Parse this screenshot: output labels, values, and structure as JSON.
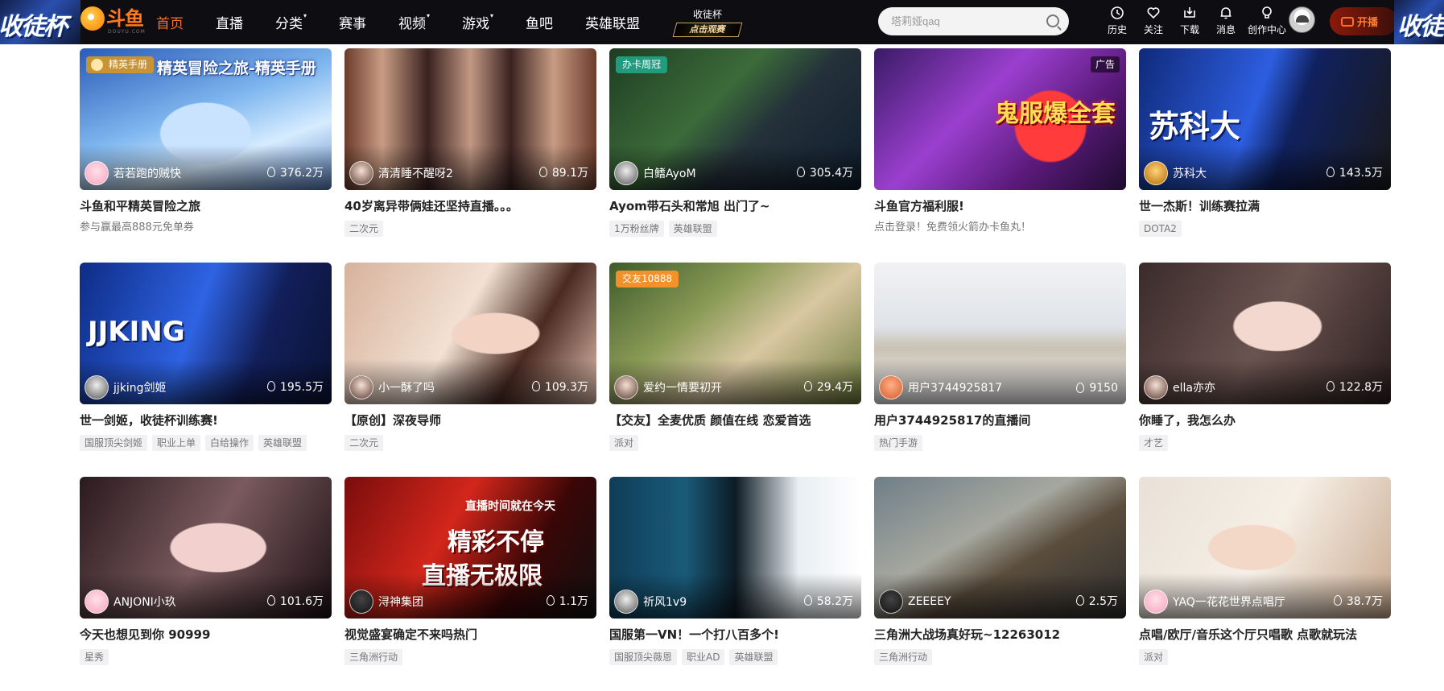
{
  "header": {
    "banner_text": "收徒杯",
    "logo_text": "斗鱼",
    "logo_sub": "DOUYU.COM",
    "nav": [
      {
        "label": "首页",
        "active": true,
        "caret": false
      },
      {
        "label": "直播",
        "active": false,
        "caret": false
      },
      {
        "label": "分类",
        "active": false,
        "caret": true
      },
      {
        "label": "赛事",
        "active": false,
        "caret": false
      },
      {
        "label": "视频",
        "active": false,
        "caret": true
      },
      {
        "label": "游戏",
        "active": false,
        "caret": true
      },
      {
        "label": "鱼吧",
        "active": false,
        "caret": false
      },
      {
        "label": "英雄联盟",
        "active": false,
        "caret": false
      }
    ],
    "caret_glyph": "▾",
    "promo": {
      "line1": "收徒杯",
      "line2": "点击观赛"
    },
    "search_placeholder": "塔莉娅qaq",
    "tools": [
      {
        "label": "历史",
        "icon": "clock-icon"
      },
      {
        "label": "关注",
        "icon": "heart-icon"
      },
      {
        "label": "下载",
        "icon": "download-icon"
      },
      {
        "label": "消息",
        "icon": "bell-icon"
      },
      {
        "label": "创作中心",
        "icon": "bulb-icon"
      }
    ],
    "live_button": "开播",
    "accent_color": "#ff6d28"
  },
  "cards": [
    {
      "badge": "精英手册",
      "badge_style": "gold",
      "art_text": "精英冒险之旅-精英手册",
      "streamer": "若若跑的贼快",
      "viewers": "376.2万",
      "title": "斗鱼和平精英冒险之旅",
      "subtitle": "参与赢最高888元免单券",
      "tags": []
    },
    {
      "streamer": "清清睡不醒呀2",
      "viewers": "89.1万",
      "title": "40岁离异带俩娃还坚持直播。。。",
      "tags": [
        "二次元"
      ]
    },
    {
      "badge": "办卡周冠",
      "badge_style": "green",
      "streamer": "白鳍AyoM",
      "viewers": "305.4万",
      "title": "Ayom带石头和常旭 出门了~",
      "tags": [
        "1万粉丝牌",
        "英雄联盟"
      ]
    },
    {
      "ad": "广告",
      "art_text": "鬼服爆全套",
      "title": "斗鱼官方福利服!",
      "subtitle": "点击登录！免费领火箭办卡鱼丸！",
      "tags": []
    },
    {
      "art_text": "苏科大",
      "streamer": "苏科大",
      "viewers": "143.5万",
      "title": "世一杰斯！训练赛拉满",
      "tags": [
        "DOTA2"
      ]
    },
    {
      "art_text": "JJKING",
      "streamer": "jjking剑姬",
      "viewers": "195.5万",
      "title": "世一剑姬，收徒杯训练赛!",
      "tags": [
        "国服顶尖剑姬",
        "职业上单",
        "白给操作",
        "英雄联盟"
      ]
    },
    {
      "streamer": "小一酥了吗",
      "viewers": "109.3万",
      "title": "【原创】深夜导师",
      "tags": [
        "二次元"
      ]
    },
    {
      "badge": "交友10888",
      "badge_style": "orange",
      "streamer": "爱约一情要初开",
      "viewers": "29.4万",
      "title": "【交友】全麦优质 颜值在线 恋爱首选",
      "tags": [
        "派对"
      ]
    },
    {
      "streamer": "用户3744925817",
      "viewers": "9150",
      "title": "用户3744925817的直播间",
      "tags": [
        "热门手游"
      ]
    },
    {
      "streamer": "ella亦亦",
      "viewers": "122.8万",
      "title": "你睡了，我怎么办",
      "tags": [
        "才艺"
      ]
    },
    {
      "streamer": "ANJONI小玖",
      "viewers": "101.6万",
      "title": "今天也想见到你 90999",
      "tags": [
        "星秀"
      ]
    },
    {
      "art_text": "精彩不停",
      "art_text2": "直播无极限",
      "art_text3": "直播时间就在今天",
      "streamer": "浔神集团",
      "viewers": "1.1万",
      "title": "视觉盛宴确定不来吗热门",
      "tags": [
        "三角洲行动"
      ]
    },
    {
      "streamer": "祈风1v9",
      "viewers": "58.2万",
      "title": "国服第一VN！一个打八百多个!",
      "tags": [
        "国服顶尖薇恩",
        "职业AD",
        "英雄联盟"
      ]
    },
    {
      "streamer": "ZEEEEY",
      "viewers": "2.5万",
      "title": "三角洲大战场真好玩~1226301​2",
      "tags": [
        "三角洲行动"
      ]
    },
    {
      "streamer": "YAQ一花花世界点唱厅",
      "viewers": "38.7万",
      "title": "点唱/欧厅/音乐这个厅只唱歌 点歌就玩法",
      "tags": [
        "派对"
      ]
    }
  ]
}
